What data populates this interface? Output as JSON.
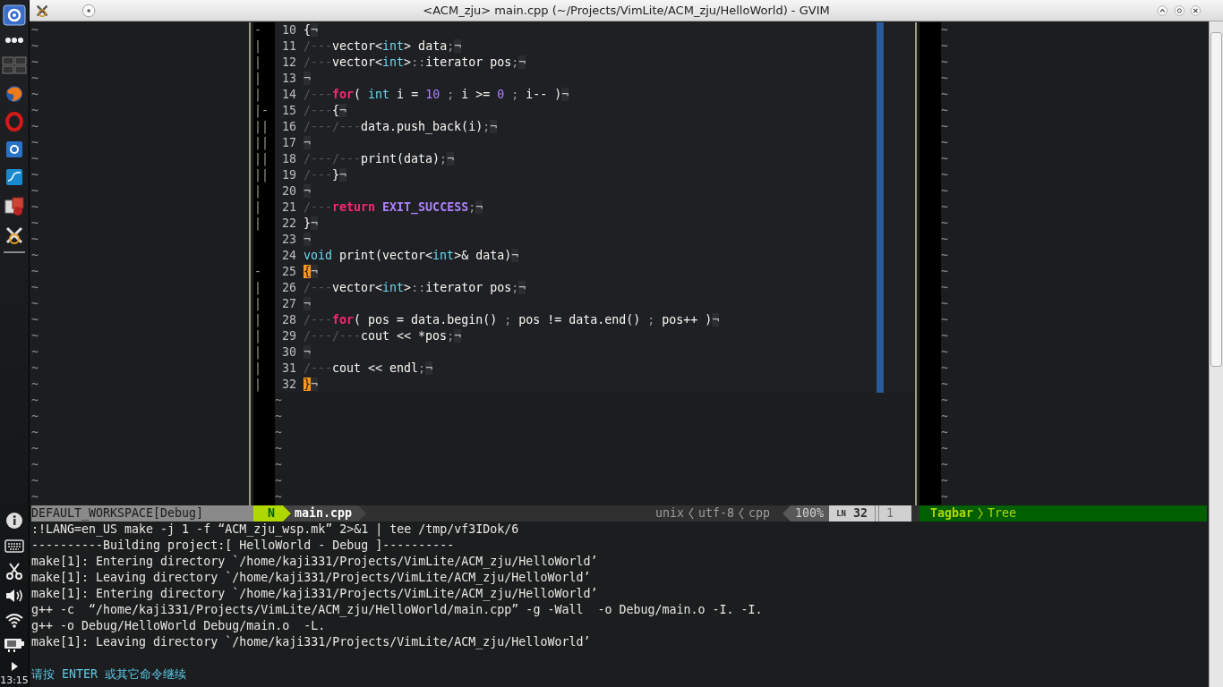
{
  "panel": {
    "clock": "13:15"
  },
  "window": {
    "title": "<ACM_zju> main.cpp (~/Projects/VimLite/ACM_zju/HelloWorld) - GVIM"
  },
  "left_pane": {
    "lines": [
      "~",
      "~",
      "~",
      "~",
      "~",
      "~",
      "~",
      "~",
      "~",
      "~",
      "~",
      "~",
      "~",
      "~",
      "~",
      "~",
      "~",
      "~",
      "~",
      "~",
      "~",
      "~",
      "~",
      "~",
      "~",
      "~",
      "~",
      "~",
      "~",
      "~"
    ]
  },
  "editor": {
    "lines": [
      {
        "number": "10",
        "fold": "-",
        "segments": [
          {
            "kind": "plain",
            "text": "{"
          }
        ],
        "eol": "¬"
      },
      {
        "number": "11",
        "fold": "|",
        "segments": [
          {
            "kind": "tab",
            "text": "/---"
          },
          {
            "kind": "plain",
            "text": "vector<"
          },
          {
            "kind": "type",
            "text": "int"
          },
          {
            "kind": "plain",
            "text": "> data"
          },
          {
            "kind": "punct",
            "text": ";"
          }
        ],
        "eol": "¬"
      },
      {
        "number": "12",
        "fold": "|",
        "segments": [
          {
            "kind": "tab",
            "text": "/---"
          },
          {
            "kind": "plain",
            "text": "vector<"
          },
          {
            "kind": "type",
            "text": "int"
          },
          {
            "kind": "plain",
            "text": ">"
          },
          {
            "kind": "punct",
            "text": "::"
          },
          {
            "kind": "plain",
            "text": "iterator pos"
          },
          {
            "kind": "punct",
            "text": ";"
          }
        ],
        "eol": "¬"
      },
      {
        "number": "13",
        "fold": "|",
        "eol": "¬"
      },
      {
        "number": "14",
        "fold": "|",
        "segments": [
          {
            "kind": "tab",
            "text": "/---"
          },
          {
            "kind": "keyword",
            "text": "for"
          },
          {
            "kind": "plain",
            "text": "( "
          },
          {
            "kind": "type",
            "text": "int"
          },
          {
            "kind": "plain",
            "text": " i = "
          },
          {
            "kind": "number",
            "text": "10"
          },
          {
            "kind": "punct",
            "text": " ; "
          },
          {
            "kind": "plain",
            "text": "i >= "
          },
          {
            "kind": "number",
            "text": "0"
          },
          {
            "kind": "punct",
            "text": " ; "
          },
          {
            "kind": "plain",
            "text": "i-- )"
          }
        ],
        "eol": "¬"
      },
      {
        "number": "15",
        "fold": "|-",
        "segments": [
          {
            "kind": "tab",
            "text": "/---"
          },
          {
            "kind": "plain",
            "text": "{"
          }
        ],
        "eol": "¬"
      },
      {
        "number": "16",
        "fold": "||",
        "segments": [
          {
            "kind": "tab",
            "text": "/---/---"
          },
          {
            "kind": "plain",
            "text": "data.push_back(i)"
          },
          {
            "kind": "punct",
            "text": ";"
          }
        ],
        "eol": "¬"
      },
      {
        "number": "17",
        "fold": "||",
        "eol": "¬"
      },
      {
        "number": "18",
        "fold": "||",
        "segments": [
          {
            "kind": "tab",
            "text": "/---/---"
          },
          {
            "kind": "plain",
            "text": "print(data)"
          },
          {
            "kind": "punct",
            "text": ";"
          }
        ],
        "eol": "¬"
      },
      {
        "number": "19",
        "fold": "||",
        "segments": [
          {
            "kind": "tab",
            "text": "/---"
          },
          {
            "kind": "plain",
            "text": "}"
          }
        ],
        "eol": "¬"
      },
      {
        "number": "20",
        "fold": "|",
        "eol": "¬"
      },
      {
        "number": "21",
        "fold": "|",
        "segments": [
          {
            "kind": "tab",
            "text": "/---"
          },
          {
            "kind": "keyword",
            "text": "return"
          },
          {
            "kind": "constant",
            "text": " EXIT_SUCCESS"
          },
          {
            "kind": "punct",
            "text": ";"
          }
        ],
        "eol": "¬"
      },
      {
        "number": "22",
        "fold": "|",
        "segments": [
          {
            "kind": "plain",
            "text": "}"
          }
        ],
        "eol": "¬"
      },
      {
        "number": "23",
        "eol": "¬"
      },
      {
        "number": "24",
        "segments": [
          {
            "kind": "type",
            "text": "void"
          },
          {
            "kind": "plain",
            "text": " print(vector<"
          },
          {
            "kind": "type",
            "text": "int"
          },
          {
            "kind": "plain",
            "text": ">& data)"
          }
        ],
        "eol": "¬"
      },
      {
        "number": "25",
        "fold": "-",
        "segments": [
          {
            "kind": "match",
            "text": "{"
          }
        ],
        "eol": "¬"
      },
      {
        "number": "26",
        "fold": "|",
        "segments": [
          {
            "kind": "tab",
            "text": "/---"
          },
          {
            "kind": "plain",
            "text": "vector<"
          },
          {
            "kind": "type",
            "text": "int"
          },
          {
            "kind": "plain",
            "text": ">"
          },
          {
            "kind": "punct",
            "text": "::"
          },
          {
            "kind": "plain",
            "text": "iterator pos"
          },
          {
            "kind": "punct",
            "text": ";"
          }
        ],
        "eol": "¬"
      },
      {
        "number": "27",
        "fold": "|",
        "eol": "¬"
      },
      {
        "number": "28",
        "fold": "|",
        "segments": [
          {
            "kind": "tab",
            "text": "/---"
          },
          {
            "kind": "keyword",
            "text": "for"
          },
          {
            "kind": "plain",
            "text": "( pos = data.begin() "
          },
          {
            "kind": "punct",
            "text": ";"
          },
          {
            "kind": "plain",
            "text": " pos != data.end() "
          },
          {
            "kind": "punct",
            "text": ";"
          },
          {
            "kind": "plain",
            "text": " pos++ )"
          }
        ],
        "eol": "¬"
      },
      {
        "number": "29",
        "fold": "|",
        "segments": [
          {
            "kind": "tab",
            "text": "/---/---"
          },
          {
            "kind": "plain",
            "text": "cout << *pos"
          },
          {
            "kind": "punct",
            "text": ";"
          }
        ],
        "eol": "¬"
      },
      {
        "number": "30",
        "fold": "|",
        "eol": "¬"
      },
      {
        "number": "31",
        "fold": "|",
        "segments": [
          {
            "kind": "tab",
            "text": "/---"
          },
          {
            "kind": "plain",
            "text": "cout << endl"
          },
          {
            "kind": "punct",
            "text": ";"
          }
        ],
        "eol": "¬"
      },
      {
        "number": "32",
        "fold": "|",
        "segments": [
          {
            "kind": "match",
            "text": "}"
          }
        ],
        "eol": "¬"
      }
    ],
    "filler": [
      "~",
      "~",
      "~",
      "~",
      "~",
      "~",
      "~"
    ]
  },
  "right_pane": {
    "lines": [
      "~",
      "~",
      "~",
      "~",
      "~",
      "~",
      "~",
      "~",
      "~",
      "~",
      "~",
      "~",
      "~",
      "~",
      "~",
      "~",
      "~",
      "~",
      "~",
      "~",
      "~",
      "~",
      "~",
      "~",
      "~",
      "~",
      "~",
      "~",
      "~",
      "~"
    ]
  },
  "status_line": {
    "workspace": "DEFAULT_WORKSPACE[Debug]",
    "mode": "N",
    "file": "main.cpp",
    "format": "unix",
    "encoding": "utf-8",
    "filetype": "cpp",
    "percent": "100%",
    "line_symbol": "LN",
    "line": "32",
    "column": "1",
    "tagbar": "Tagbar",
    "tagbar_mode": "Tree"
  },
  "messages": [
    {
      "kind": "output",
      "text": ":!LANG=en_US make -j 1 -f “ACM_zju_wsp.mk” 2>&1 | tee /tmp/vf3IDok/6"
    },
    {
      "kind": "output",
      "text": "----------Building project:[ HelloWorld - Debug ]----------"
    },
    {
      "kind": "output",
      "text": "make[1]: Entering directory `/home/kaji331/Projects/VimLite/ACM_zju/HelloWorld’"
    },
    {
      "kind": "output",
      "text": "make[1]: Leaving directory `/home/kaji331/Projects/VimLite/ACM_zju/HelloWorld’"
    },
    {
      "kind": "output",
      "text": "make[1]: Entering directory `/home/kaji331/Projects/VimLite/ACM_zju/HelloWorld’"
    },
    {
      "kind": "output",
      "text": "g++ -c  “/home/kaji331/Projects/VimLite/ACM_zju/HelloWorld/main.cpp” -g -Wall  -o Debug/main.o -I. -I."
    },
    {
      "kind": "output",
      "text": "g++ -o Debug/HelloWorld Debug/main.o  -L."
    },
    {
      "kind": "output",
      "text": "make[1]: Leaving directory `/home/kaji331/Projects/VimLite/ACM_zju/HelloWorld’"
    },
    {
      "kind": "blank"
    },
    {
      "kind": "prompt",
      "text": "请按 ENTER 或其它命令继续"
    }
  ]
}
